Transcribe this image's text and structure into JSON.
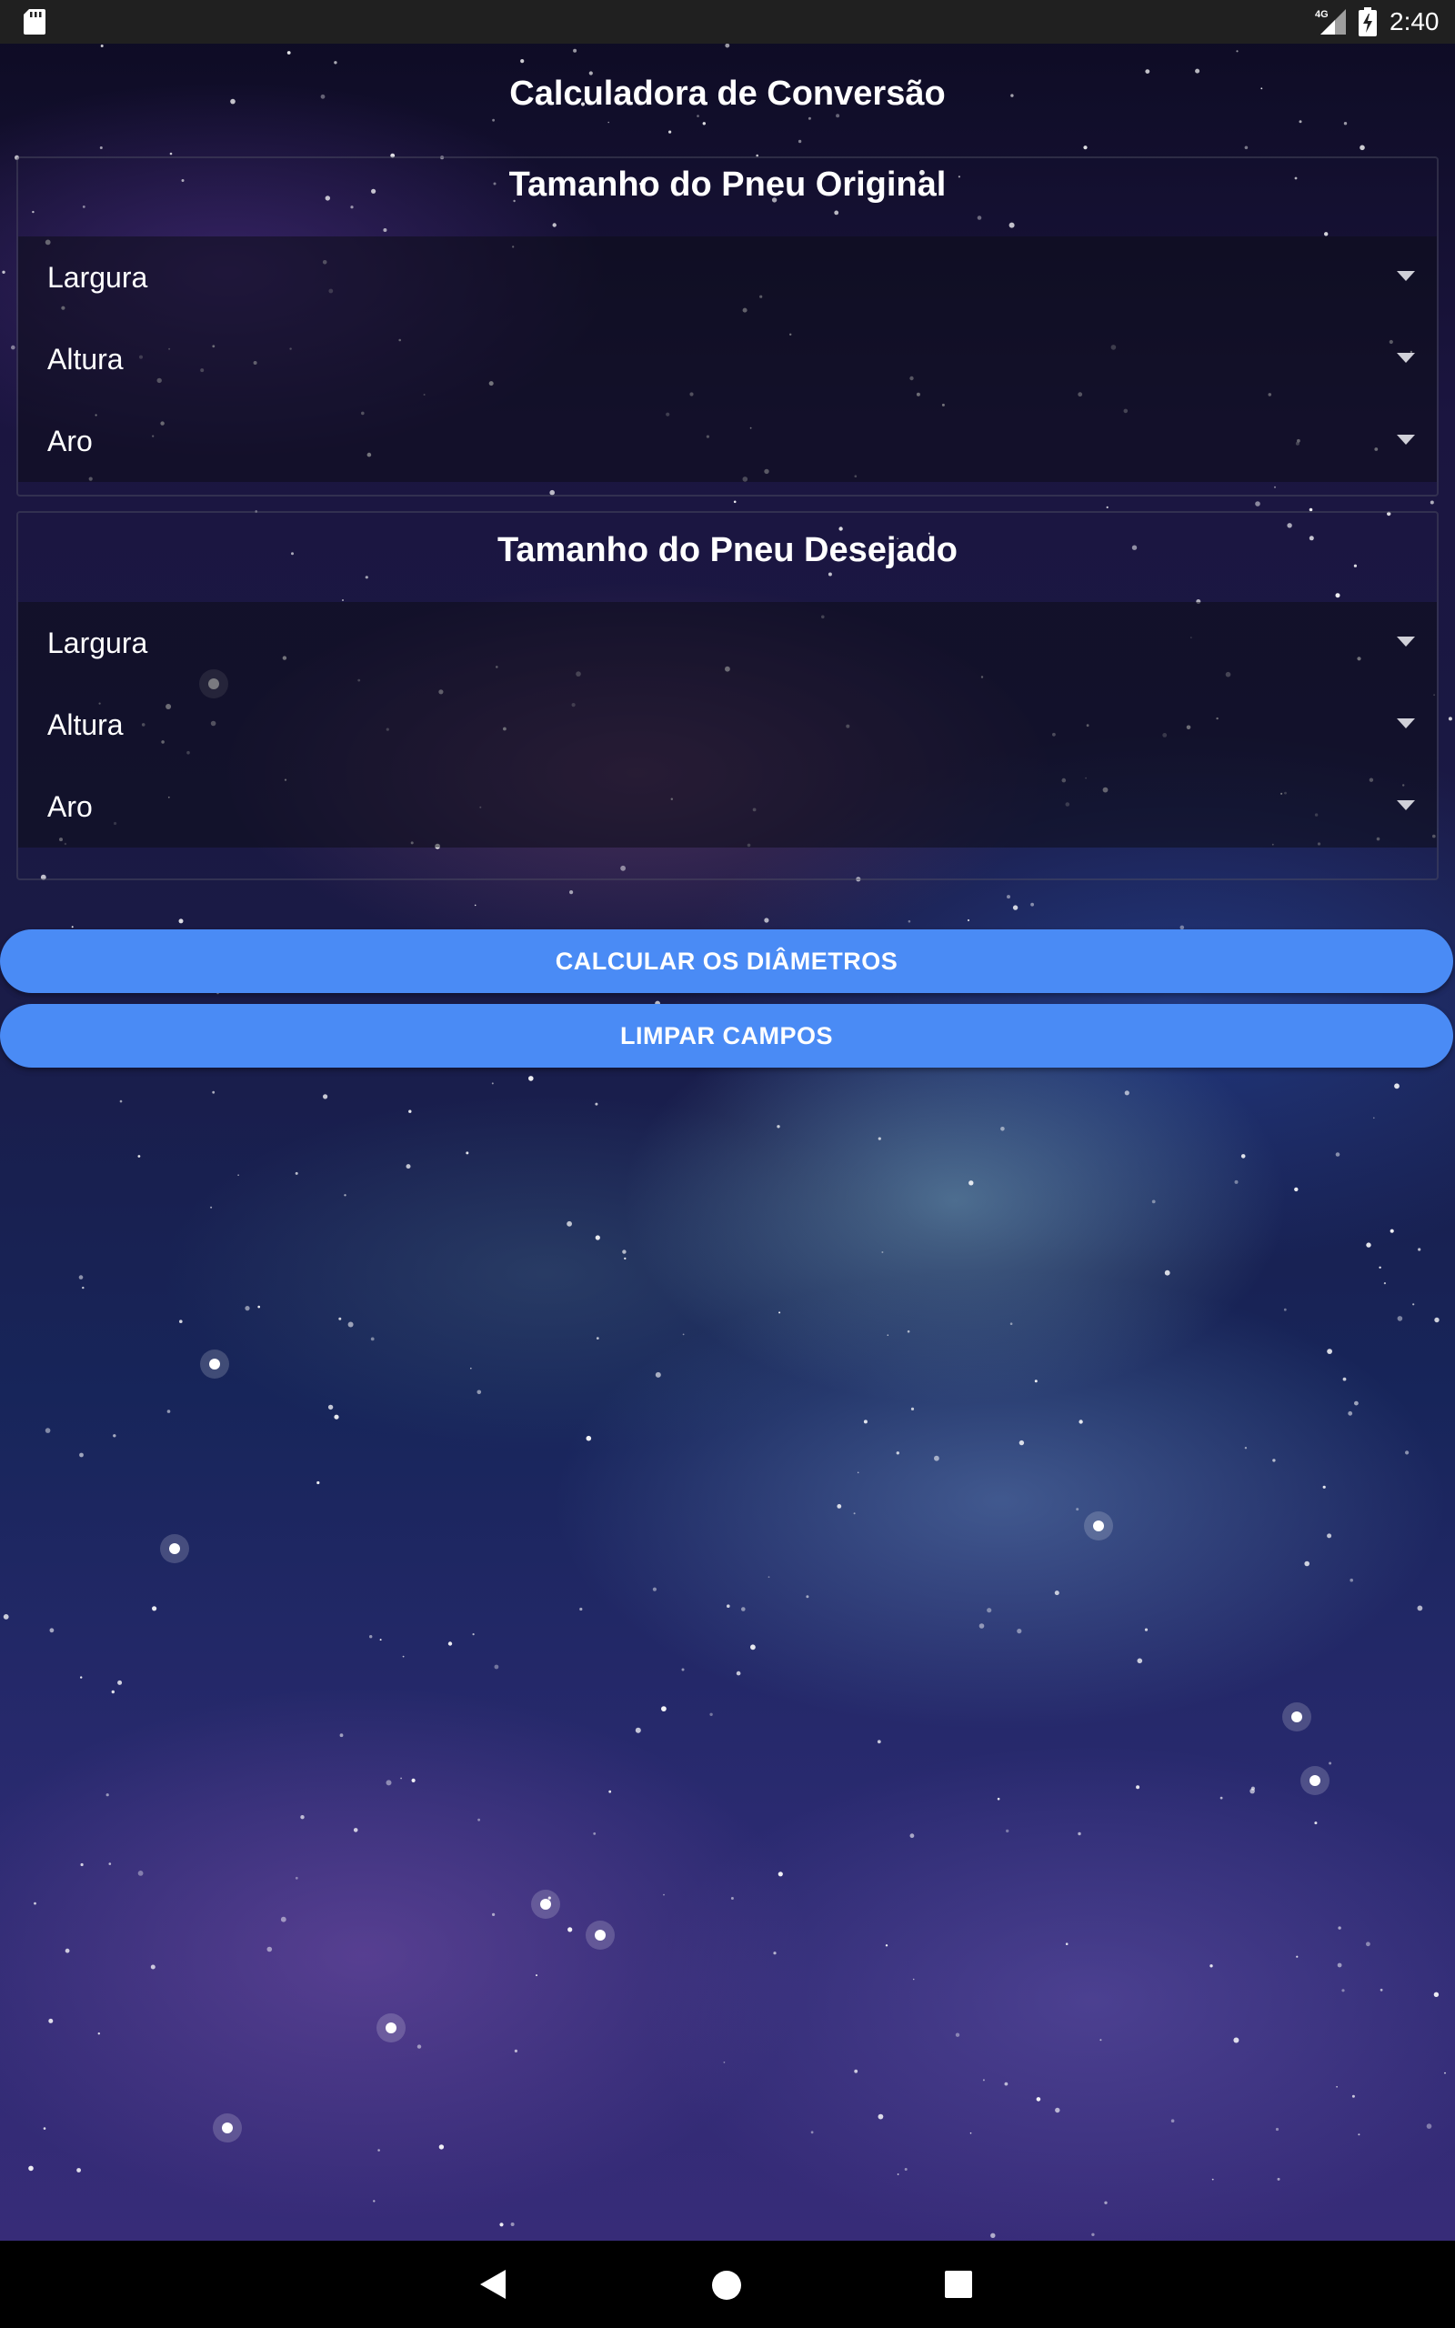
{
  "status_bar": {
    "time": "2:40",
    "network_label": "4G",
    "icons": [
      "sd-card-icon",
      "signal-icon",
      "battery-charging-icon"
    ]
  },
  "app": {
    "title": "Calculadora de Conversão"
  },
  "original": {
    "title": "Tamanho do Pneu Original",
    "fields": [
      "Largura",
      "Altura",
      "Aro"
    ]
  },
  "desired": {
    "title": "Tamanho do Pneu Desejado",
    "fields": [
      "Largura",
      "Altura",
      "Aro"
    ]
  },
  "buttons": {
    "calculate": "CALCULAR OS DIÂMETROS",
    "clear": "LIMPAR CAMPOS"
  },
  "colors": {
    "button": "#4a8bf5",
    "status_bar": "#202020",
    "nav_bar": "#000000"
  },
  "nav_bar": {
    "icons": [
      "back-icon",
      "home-icon",
      "recents-icon"
    ]
  }
}
